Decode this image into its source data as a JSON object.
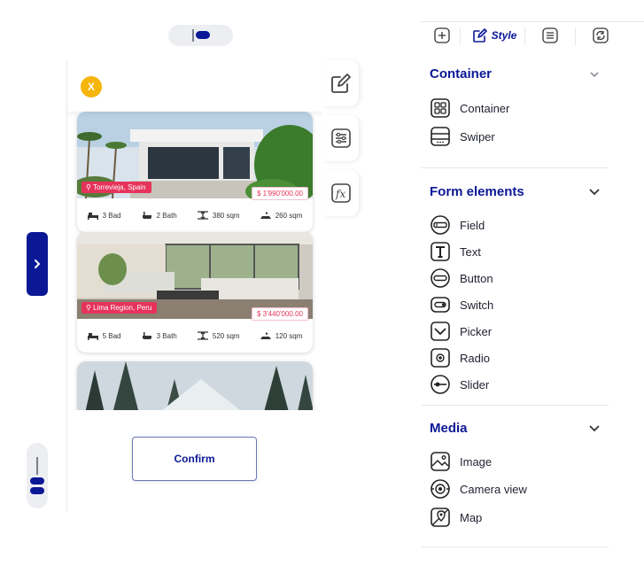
{
  "builder": {
    "close_label": "X",
    "confirm_label": "Confirm"
  },
  "listings": [
    {
      "location": "Torrevieja, Spain",
      "price": "$ 1'990'000.00",
      "beds": "3 Bad",
      "baths": "2 Bath",
      "area": "380 sqm",
      "lot": "260 sqm"
    },
    {
      "location": "Lima Region, Peru",
      "price": "$ 3'440'000.00",
      "beds": "5 Bad",
      "baths": "3 Bath",
      "area": "520 sqm",
      "lot": "120 sqm"
    },
    {
      "location": "",
      "price": "",
      "beds": "",
      "baths": "",
      "area": "",
      "lot": ""
    }
  ],
  "tabs": {
    "style_label": "Style"
  },
  "sections": {
    "container": {
      "title": "Container",
      "items": [
        "Container",
        "Swiper"
      ]
    },
    "form": {
      "title": "Form elements",
      "items": [
        "Field",
        "Text",
        "Button",
        "Switch",
        "Picker",
        "Radio",
        "Slider"
      ]
    },
    "media": {
      "title": "Media",
      "items": [
        "Image",
        "Camera view",
        "Map"
      ]
    }
  },
  "colors": {
    "accent": "#0b1896",
    "badge": "#e6335b",
    "close": "#f5b50a"
  }
}
